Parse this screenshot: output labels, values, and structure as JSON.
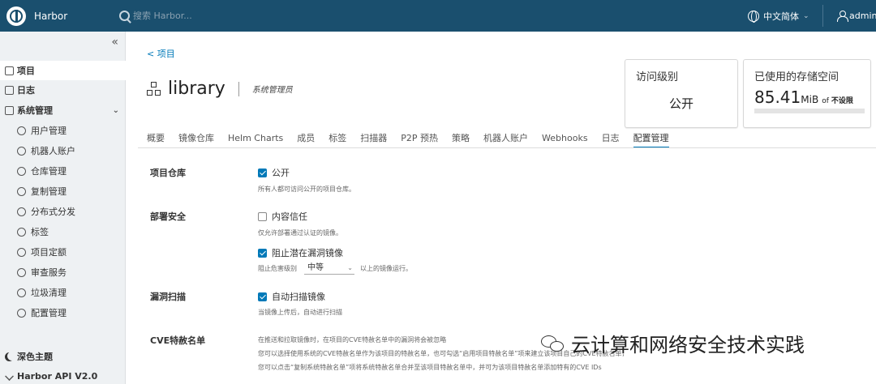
{
  "header": {
    "brand": "Harbor",
    "search_placeholder": "搜索 Harbor...",
    "language": "中文简体",
    "user": "admin"
  },
  "sidebar": {
    "items": [
      {
        "label": "项目",
        "icon": "project-icon"
      },
      {
        "label": "日志",
        "icon": "log-icon"
      },
      {
        "label": "系统管理",
        "icon": "admin-icon"
      },
      {
        "label": "用户管理",
        "icon": "users-icon"
      },
      {
        "label": "机器人账户",
        "icon": "robot-icon"
      },
      {
        "label": "仓库管理",
        "icon": "registry-icon"
      },
      {
        "label": "复制管理",
        "icon": "replication-icon"
      },
      {
        "label": "分布式分发",
        "icon": "distribution-icon"
      },
      {
        "label": "标签",
        "icon": "tag-icon"
      },
      {
        "label": "项目定额",
        "icon": "quota-icon"
      },
      {
        "label": "审查服务",
        "icon": "interrogation-icon"
      },
      {
        "label": "垃圾清理",
        "icon": "trash-icon"
      },
      {
        "label": "配置管理",
        "icon": "settings-icon"
      }
    ],
    "dark_theme": "深色主题",
    "api": "Harbor API V2.0"
  },
  "main": {
    "back": "< 项目",
    "title": "library",
    "role": "系统管理员",
    "access_card": {
      "title": "访问级别",
      "value": "公开"
    },
    "storage_card": {
      "title": "已使用的存储空间",
      "value": "85.41",
      "unit": "MiB",
      "of": "of",
      "limit": "不设限"
    },
    "tabs": [
      "概要",
      "镜像仓库",
      "Helm Charts",
      "成员",
      "标签",
      "扫描器",
      "P2P 预热",
      "策略",
      "机器人账户",
      "Webhooks",
      "日志",
      "配置管理"
    ],
    "active_tab": "配置管理",
    "sections": {
      "repo": {
        "label": "项目仓库",
        "public_label": "公开",
        "public_help": "所有人都可访问公开的项目仓库。"
      },
      "deploy": {
        "label": "部署安全",
        "trust_label": "内容信任",
        "trust_help": "仅允许部署通过认证的镜像。",
        "prevent_label": "阻止潜在漏洞镜像",
        "severity_prefix": "阻止危害级别",
        "severity_value": "中等",
        "severity_suffix": "以上的镜像运行。"
      },
      "scan": {
        "label": "漏洞扫描",
        "auto_label": "自动扫描镜像",
        "auto_help": "当镜像上传后，自动进行扫描"
      },
      "cve": {
        "label": "CVE特赦名单",
        "line1": "在推送和拉取镜像时，在项目的CVE特赦名单中的漏洞将会被忽略",
        "line2": "您可以选择使用系统的CVE特赦名单作为该项目的特赦名单，也可勾选“启用项目特赦名单”项来建立该项目自己的CVE特赦名单，",
        "line3": "您可以点击“复制系统特赦名单”项将系统特赦名单合并至该项目特赦名单中，并可为该项目特赦名单添加特有的CVE IDs"
      }
    }
  },
  "watermark": "云计算和网络安全技术实践",
  "colors": {
    "header": "#1a4f6e",
    "accent": "#0079b8",
    "sidebar": "#eef1f3"
  }
}
